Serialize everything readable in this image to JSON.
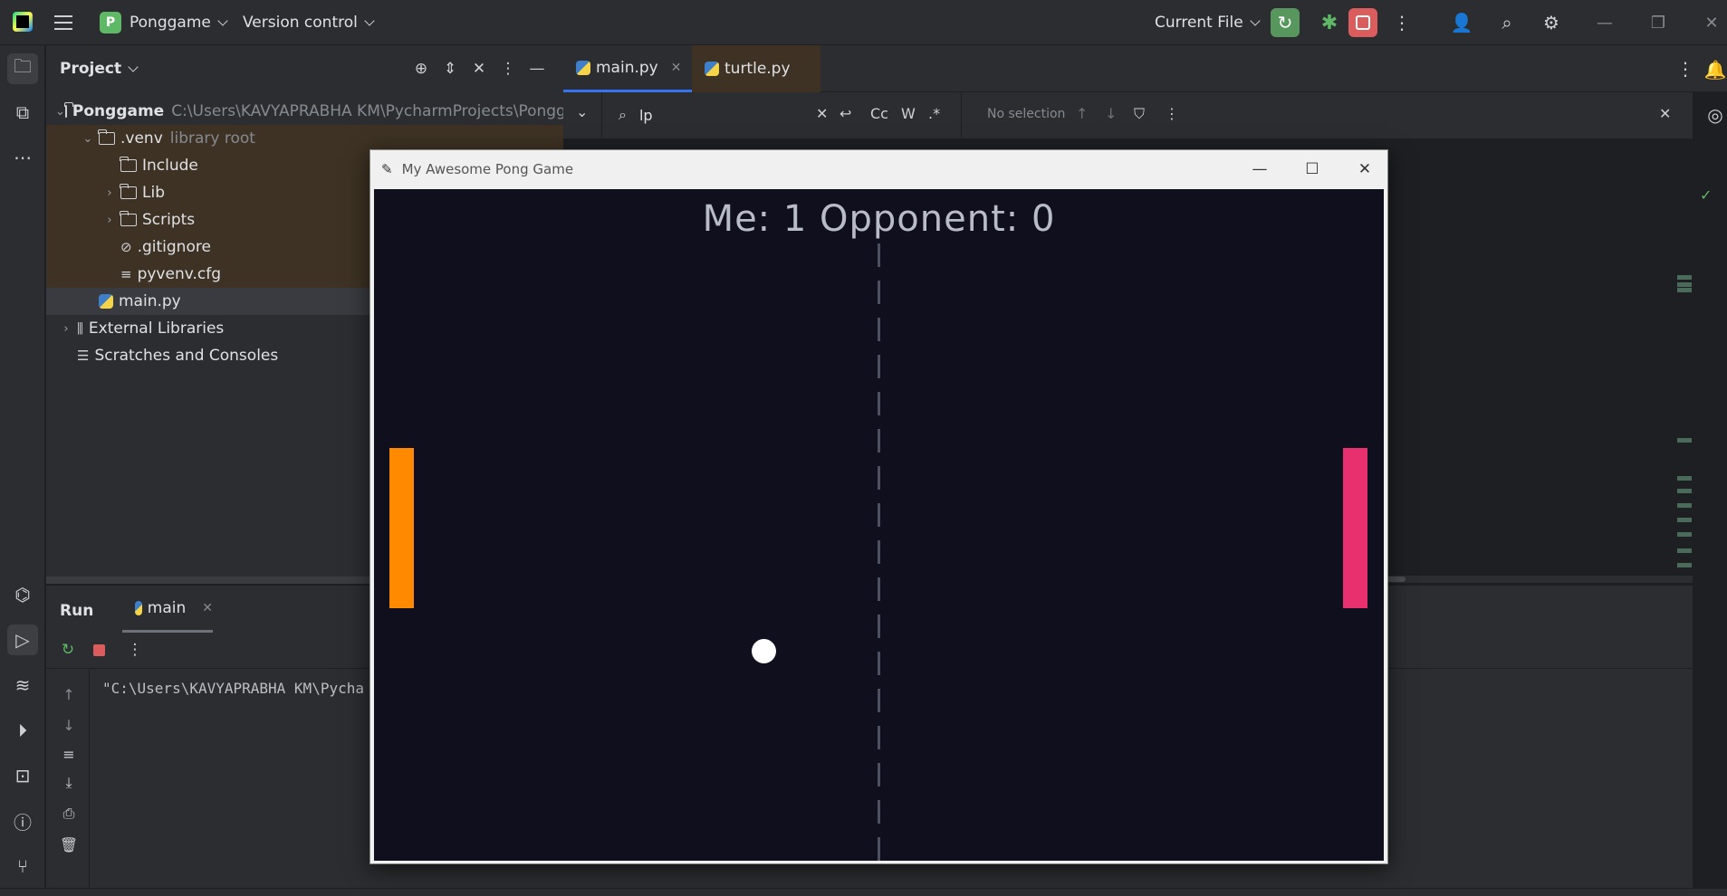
{
  "titlebar": {
    "project_badge": "P",
    "project_name": "Ponggame",
    "version_control": "Version control",
    "run_config": "Current File"
  },
  "project_panel": {
    "title": "Project",
    "tree": [
      {
        "name": "Ponggame",
        "extra": "C:\\Users\\KAVYAPRABHA KM\\PycharmProjects\\Ponggame"
      },
      {
        "name": ".venv",
        "extra": "library root"
      },
      {
        "name": "Include"
      },
      {
        "name": "Lib"
      },
      {
        "name": "Scripts"
      },
      {
        "name": ".gitignore"
      },
      {
        "name": "pyvenv.cfg"
      },
      {
        "name": "main.py"
      },
      {
        "name": "External Libraries"
      },
      {
        "name": "Scratches and Consoles"
      }
    ]
  },
  "editor": {
    "tabs": [
      {
        "label": "main.py"
      },
      {
        "label": "turtle.py"
      }
    ],
    "find": {
      "query": "lp",
      "opt_case": "Cc",
      "opt_word": "W",
      "opt_regex": ".*",
      "selection_status": "No selection"
    }
  },
  "run_panel": {
    "title": "Run",
    "tab_label": "main",
    "console_line": "\"C:\\Users\\KAVYAPRABHA KM\\Pycha"
  },
  "game_window": {
    "title": "My Awesome Pong Game",
    "score_text": "Me: 1  Opponent: 0",
    "colors": {
      "background": "#100f1d",
      "left_paddle": "#ff8a00",
      "right_paddle": "#e8306f",
      "ball": "#ffffff"
    }
  }
}
